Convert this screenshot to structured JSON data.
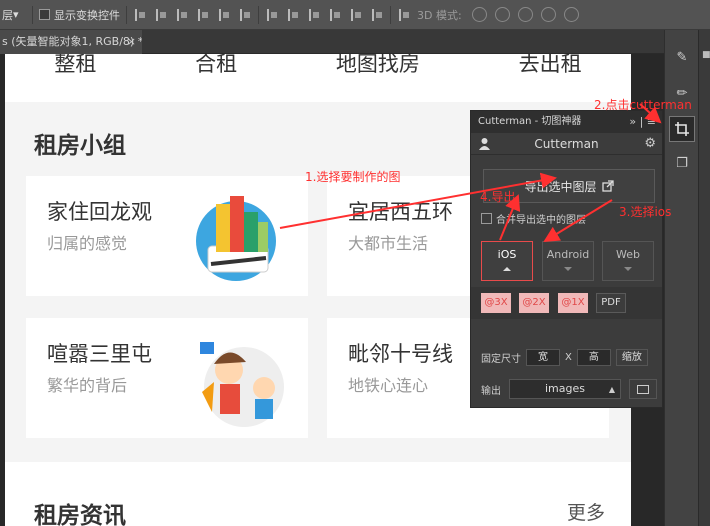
{
  "optionsbar": {
    "layer_select": "层",
    "transform_label": "显示变换控件",
    "mode_label": "3D 模式:"
  },
  "tab": {
    "title": "s (矢量智能对象1, RGB/8) *",
    "close": "×"
  },
  "page": {
    "nav": [
      "整租",
      "合租",
      "地图找房",
      "去出租"
    ],
    "group_title": "租房小组",
    "cards": [
      {
        "title": "家住回龙观",
        "sub": "归属的感觉"
      },
      {
        "title": "宜居西五环",
        "sub": "大都市生活"
      },
      {
        "title": "喧嚣三里屯",
        "sub": "繁华的背后"
      },
      {
        "title": "毗邻十号线",
        "sub": "地铁心连心"
      }
    ],
    "news_title": "租房资讯",
    "news_more": "更多"
  },
  "panel": {
    "title": "Cutterman - 切图神器",
    "collapse": "»",
    "menu": "≡",
    "user": "Cutterman",
    "export_label": "导出选中图层",
    "merge_label": "合并导出选中的图层",
    "platforms": [
      "iOS",
      "Android",
      "Web"
    ],
    "scales": [
      "@3X",
      "@2X",
      "@1X",
      "PDF"
    ],
    "fixed_label": "固定尺寸",
    "width_label": "宽",
    "x_label": "X",
    "height_label": "高",
    "scale_btn": "缩放",
    "output_label": "输出",
    "output_value": "images"
  },
  "annotations": {
    "step1": "1.选择要制作的图",
    "step2": "2.点击cutterman",
    "step3": "3.选择ios",
    "step4": "4.导出"
  },
  "colors": {
    "accent": "#e84b4b",
    "annotation": "#ff3030"
  }
}
